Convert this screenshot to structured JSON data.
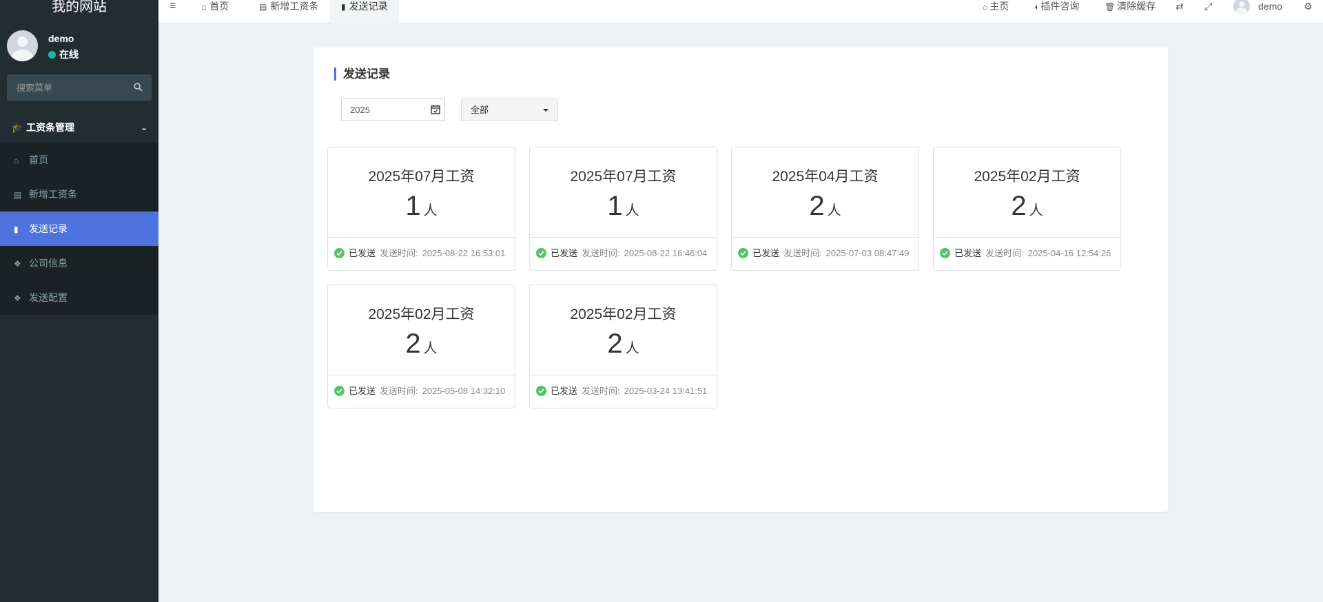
{
  "sidebar": {
    "brand": "我的网站",
    "user": {
      "name": "demo",
      "status": "在线"
    },
    "search_placeholder": "搜索菜单",
    "menu_header": "工资条管理",
    "items": [
      {
        "label": "首页",
        "icon": "home-icon"
      },
      {
        "label": "新增工资条",
        "icon": "form-icon"
      },
      {
        "label": "发送记录",
        "icon": "file-icon",
        "active": true
      },
      {
        "label": "公司信息",
        "icon": "cubes-icon"
      },
      {
        "label": "发送配置",
        "icon": "cubes-icon"
      }
    ]
  },
  "navbar": {
    "tabs": [
      {
        "label": "首页",
        "icon": "home-icon"
      },
      {
        "label": "新增工资条",
        "icon": "form-icon"
      },
      {
        "label": "发送记录",
        "icon": "file-icon",
        "active": true
      }
    ],
    "right": {
      "home": "主页",
      "plugin": "插件咨询",
      "clear_cache": "清除缓存",
      "username": "demo"
    }
  },
  "page": {
    "title": "发送记录",
    "year_filter": "2025",
    "status_filter": "全部"
  },
  "records": [
    {
      "title": "2025年07月工资",
      "count": "1",
      "unit": "人",
      "status": "已发送",
      "time_label": "发送时间:",
      "time": "2025-08-22 16:53:01"
    },
    {
      "title": "2025年07月工资",
      "count": "1",
      "unit": "人",
      "status": "已发送",
      "time_label": "发送时间:",
      "time": "2025-08-22 16:46:04"
    },
    {
      "title": "2025年04月工资",
      "count": "2",
      "unit": "人",
      "status": "已发送",
      "time_label": "发送时间:",
      "time": "2025-07-03 08:47:49"
    },
    {
      "title": "2025年02月工资",
      "count": "2",
      "unit": "人",
      "status": "已发送",
      "time_label": "发送时间:",
      "time": "2025-04-16 12:54:26"
    },
    {
      "title": "2025年02月工资",
      "count": "2",
      "unit": "人",
      "status": "已发送",
      "time_label": "发送时间:",
      "time": "2025-05-08 14:32:10"
    },
    {
      "title": "2025年02月工资",
      "count": "2",
      "unit": "人",
      "status": "已发送",
      "time_label": "发送时间:",
      "time": "2025-03-24 13:41:51"
    }
  ],
  "colors": {
    "sidebar_bg": "#222d32",
    "active_item": "#4e73df",
    "success": "#54c36d"
  }
}
